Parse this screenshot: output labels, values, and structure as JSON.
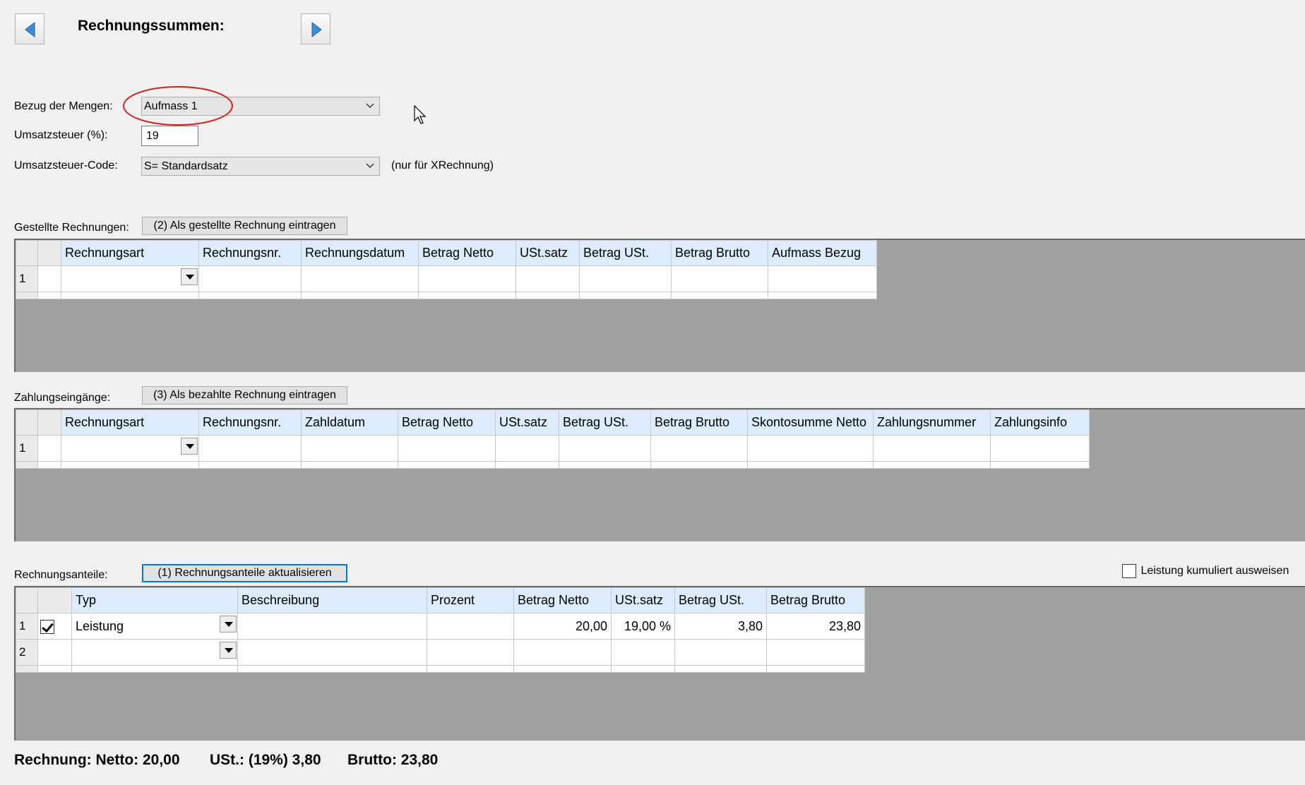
{
  "header": {
    "title": "Rechnungssummen:"
  },
  "settings": {
    "bezug_label": "Bezug der Mengen:",
    "bezug_value": "Aufmass 1",
    "ust_label": "Umsatzsteuer (%):",
    "ust_value": "19",
    "code_label": "Umsatzsteuer-Code:",
    "code_value": "S= Standardsatz",
    "code_note": "(nur für XRechnung)"
  },
  "gestellt": {
    "label": "Gestellte Rechnungen:",
    "button": "(2) Als gestellte Rechnung eintragen",
    "columns": [
      "Rechnungsart",
      "Rechnungsnr.",
      "Rechnungsdatum",
      "Betrag Netto",
      "USt.satz",
      "Betrag USt.",
      "Betrag Brutto",
      "Aufmass Bezug"
    ],
    "rows": [
      {
        "num": "1"
      }
    ]
  },
  "zahlung": {
    "label": "Zahlungseingänge:",
    "button": "(3) Als bezahlte Rechnung eintragen",
    "columns": [
      "Rechnungsart",
      "Rechnungsnr.",
      "Zahldatum",
      "Betrag Netto",
      "USt.satz",
      "Betrag USt.",
      "Betrag Brutto",
      "Skontosumme Netto",
      "Zahlungsnummer",
      "Zahlungsinfo"
    ],
    "rows": [
      {
        "num": "1"
      }
    ]
  },
  "anteile": {
    "label": "Rechnungsanteile:",
    "button": "(1) Rechnungsanteile aktualisieren",
    "kumuliert_label": "Leistung kumuliert ausweisen",
    "kumuliert_checked": false,
    "columns": [
      "Typ",
      "Beschreibung",
      "Prozent",
      "Betrag Netto",
      "USt.satz",
      "Betrag USt.",
      "Betrag Brutto"
    ],
    "rows": [
      {
        "num": "1",
        "checked": true,
        "typ": "Leistung",
        "beschreibung": "",
        "prozent": "",
        "netto": "20,00",
        "ustsatz": "19,00 %",
        "ust": "3,80",
        "brutto": "23,80"
      },
      {
        "num": "2",
        "checked": false,
        "typ": "",
        "beschreibung": "",
        "prozent": "",
        "netto": "",
        "ustsatz": "",
        "ust": "",
        "brutto": ""
      }
    ]
  },
  "summary": {
    "netto": "Rechnung: Netto: 20,00",
    "ust": "USt.: (19%) 3,80",
    "brutto": "Brutto: 23,80"
  },
  "colors": {
    "accent": "#0078d7",
    "grid_header": "#dcecfc",
    "grid_bg": "#a0a0a0",
    "highlight_circle": "#d22020"
  },
  "icons": {
    "prev": "arrow-left-icon",
    "next": "arrow-right-icon",
    "dropdown": "chevron-down-icon"
  }
}
